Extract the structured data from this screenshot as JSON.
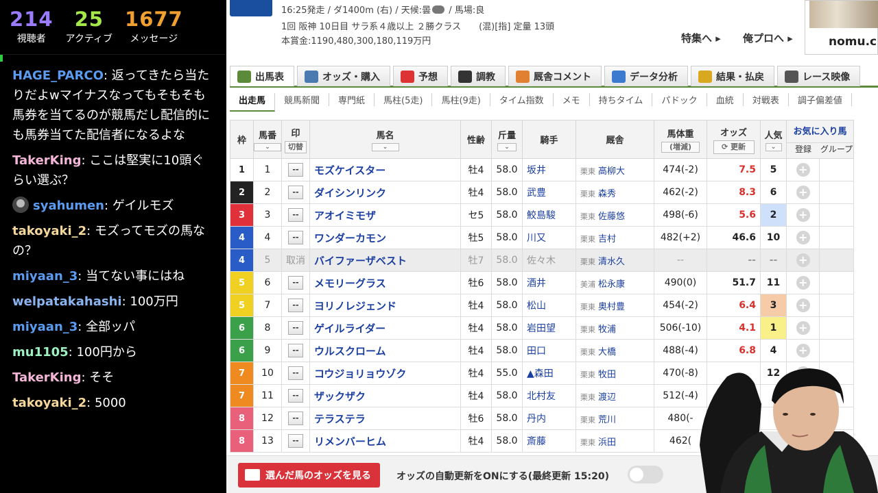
{
  "stats": [
    {
      "value": "214",
      "label": "視聴者",
      "color": "#9b7bff"
    },
    {
      "value": "25",
      "label": "アクティブ",
      "color": "#a5e84a"
    },
    {
      "value": "1677",
      "label": "メッセージ",
      "color": "#f0a030"
    }
  ],
  "chat": [
    {
      "user": "HAGE_PARCO",
      "text": "返ってきたら当たりだよwマイナスなってもそもそも馬券を当てるのが競馬だし配信的にも馬券当てた配信者になるよな",
      "color": "#5b9bf0"
    },
    {
      "user": "TakerKing",
      "text": "ここは堅実に10頭ぐらい選ぶ？",
      "color": "#f4b6d8"
    },
    {
      "user": "syahumen",
      "text": "ゲイルモズ",
      "color": "#5b9bf0",
      "avatar": true
    },
    {
      "user": "takoyaki_2",
      "text": "モズってモズの馬なの？",
      "color": "#f4d79a"
    },
    {
      "user": "miyaan_3",
      "text": "当てない事にはね",
      "color": "#5b9bf0"
    },
    {
      "user": "welpatakahashi",
      "text": "100万円",
      "color": "#8ab4f0"
    },
    {
      "user": "miyaan_3",
      "text": "全部ッパ",
      "color": "#5b9bf0"
    },
    {
      "user": "mu1105",
      "text": "100円から",
      "color": "#9ef0c0"
    },
    {
      "user": "TakerKing",
      "text": "そそ",
      "color": "#f4b6d8"
    },
    {
      "user": "takoyaki_2",
      "text": "5000",
      "color": "#f4d79a"
    }
  ],
  "race": {
    "line1a": "16:25発走 / ダ1400m (右) / 天候:曇",
    "line1b": " / 馬場:良",
    "line2": "1回 阪神 10日目 サラ系４歳以上 ２勝クラス　　(混)[指] 定量 13頭",
    "line3": "本賞金:1190,480,300,180,119万円"
  },
  "links": {
    "tokushu": "特集へ ▸",
    "orepuro": "俺プロへ ▸"
  },
  "ad": {
    "text": "nomu.c"
  },
  "tabs": [
    {
      "label": "出馬表",
      "icon_color": "#5a8a3a"
    },
    {
      "label": "オッズ・購入",
      "icon_color": "#4a7ab0"
    },
    {
      "label": "予想",
      "icon_color": "#d33"
    },
    {
      "label": "調教",
      "icon_color": "#333"
    },
    {
      "label": "厩舎コメント",
      "icon_color": "#e08030"
    },
    {
      "label": "データ分析",
      "icon_color": "#3a7acf"
    },
    {
      "label": "結果・払戻",
      "icon_color": "#d8a820"
    },
    {
      "label": "レース映像",
      "icon_color": "#555"
    }
  ],
  "subnav": [
    "出走馬",
    "競馬新聞",
    "専門紙",
    "馬柱(5走)",
    "馬柱(9走)",
    "タイム指数",
    "メモ",
    "持ちタイム",
    "パドック",
    "血統",
    "対戦表",
    "調子偏差値"
  ],
  "headers": {
    "waku": "枠",
    "umaban": "馬番",
    "mark": "印",
    "mark_sub": "切替",
    "name": "馬名",
    "sexage": "性齢",
    "weight": "斤量",
    "jockey": "騎手",
    "trainer": "厩舎",
    "body": "馬体重",
    "body_sub": "(増減)",
    "odds": "オッズ",
    "odds_btn": "更新",
    "pop": "人気",
    "fav": "お気に入り馬",
    "fav_reg": "登録",
    "fav_group": "グループ"
  },
  "horses": [
    {
      "waku": "1",
      "wcolor": "#ffffff",
      "wtext": "#222",
      "num": "1",
      "mark": "--",
      "name": "モズケイスター",
      "sa": "牡4",
      "wt": "58.0",
      "jockey": "坂井",
      "area": "栗東",
      "trainer": "高柳大",
      "body": "474(-2)",
      "odds": "7.5",
      "hot": true,
      "pop": "5",
      "popbg": ""
    },
    {
      "waku": "2",
      "wcolor": "#222222",
      "wtext": "#fff",
      "num": "2",
      "mark": "--",
      "name": "ダイシンリンク",
      "sa": "牡4",
      "wt": "58.0",
      "jockey": "武豊",
      "area": "栗東",
      "trainer": "森秀",
      "body": "462(-2)",
      "odds": "8.3",
      "hot": true,
      "pop": "6",
      "popbg": ""
    },
    {
      "waku": "3",
      "wcolor": "#e0303a",
      "wtext": "#fff",
      "num": "3",
      "mark": "--",
      "name": "アオイミモザ",
      "sa": "セ5",
      "wt": "58.0",
      "jockey": "鮫島駿",
      "area": "栗東",
      "trainer": "佐藤悠",
      "body": "498(-6)",
      "odds": "5.6",
      "hot": true,
      "pop": "2",
      "popbg": "#cfe0fb"
    },
    {
      "waku": "4",
      "wcolor": "#2a5cc8",
      "wtext": "#fff",
      "num": "4",
      "mark": "--",
      "name": "ワンダーカモン",
      "sa": "牡5",
      "wt": "58.0",
      "jockey": "川又",
      "area": "栗東",
      "trainer": "吉村",
      "body": "482(+2)",
      "odds": "46.6",
      "hot": false,
      "pop": "10",
      "popbg": ""
    },
    {
      "waku": "4",
      "wcolor": "#2a5cc8",
      "wtext": "#fff",
      "num": "5",
      "mark": "取消",
      "name": "バイファーザベスト",
      "sa": "牡7",
      "wt": "58.0",
      "jockey": "佐々木",
      "area": "栗東",
      "trainer": "清水久",
      "body": "--",
      "odds": "--",
      "hot": false,
      "pop": "--",
      "popbg": "",
      "scratched": true
    },
    {
      "waku": "5",
      "wcolor": "#f0d020",
      "wtext": "#fff",
      "num": "6",
      "mark": "--",
      "name": "メモリーグラス",
      "sa": "牡6",
      "wt": "58.0",
      "jockey": "酒井",
      "area": "美浦",
      "trainer": "松永康",
      "body": "490(0)",
      "odds": "51.7",
      "hot": false,
      "pop": "11",
      "popbg": ""
    },
    {
      "waku": "5",
      "wcolor": "#f0d020",
      "wtext": "#fff",
      "num": "7",
      "mark": "--",
      "name": "ヨリノレジェンド",
      "sa": "牡4",
      "wt": "58.0",
      "jockey": "松山",
      "area": "栗東",
      "trainer": "奥村豊",
      "body": "454(-2)",
      "odds": "6.4",
      "hot": true,
      "pop": "3",
      "popbg": "#f6cba8"
    },
    {
      "waku": "6",
      "wcolor": "#3aa04a",
      "wtext": "#fff",
      "num": "8",
      "mark": "--",
      "name": "ゲイルライダー",
      "sa": "牡4",
      "wt": "58.0",
      "jockey": "岩田望",
      "area": "栗東",
      "trainer": "牧浦",
      "body": "506(-10)",
      "odds": "4.1",
      "hot": true,
      "pop": "1",
      "popbg": "#faf08a"
    },
    {
      "waku": "6",
      "wcolor": "#3aa04a",
      "wtext": "#fff",
      "num": "9",
      "mark": "--",
      "name": "ウルスクローム",
      "sa": "牡4",
      "wt": "58.0",
      "jockey": "田口",
      "area": "栗東",
      "trainer": "大橋",
      "body": "488(-4)",
      "odds": "6.8",
      "hot": true,
      "pop": "4",
      "popbg": ""
    },
    {
      "waku": "7",
      "wcolor": "#ee8a20",
      "wtext": "#fff",
      "num": "10",
      "mark": "--",
      "name": "コウジョリョウゾク",
      "sa": "牡4",
      "wt": "55.0",
      "jockey": "▲森田",
      "area": "栗東",
      "trainer": "牧田",
      "body": "470(-8)",
      "odds": "",
      "hot": false,
      "pop": "12",
      "popbg": ""
    },
    {
      "waku": "7",
      "wcolor": "#ee8a20",
      "wtext": "#fff",
      "num": "11",
      "mark": "--",
      "name": "ザックザク",
      "sa": "牡4",
      "wt": "58.0",
      "jockey": "北村友",
      "area": "栗東",
      "trainer": "渡辺",
      "body": "512(-4)",
      "odds": "",
      "hot": false,
      "pop": "",
      "popbg": ""
    },
    {
      "waku": "8",
      "wcolor": "#e8607a",
      "wtext": "#fff",
      "num": "12",
      "mark": "--",
      "name": "テラステラ",
      "sa": "牡6",
      "wt": "58.0",
      "jockey": "丹内",
      "area": "栗東",
      "trainer": "荒川",
      "body": "480(-",
      "odds": "",
      "hot": false,
      "pop": "",
      "popbg": ""
    },
    {
      "waku": "8",
      "wcolor": "#e8607a",
      "wtext": "#fff",
      "num": "13",
      "mark": "--",
      "name": "リメンバーヒム",
      "sa": "牡4",
      "wt": "58.0",
      "jockey": "斎藤",
      "area": "栗東",
      "trainer": "浜田",
      "body": "462(",
      "odds": "",
      "hot": false,
      "pop": "",
      "popbg": ""
    }
  ],
  "bottom": {
    "odds_button": "選んだ馬のオッズを見る",
    "auto_update": "オッズの自動更新をONにする(最終更新 15:20)"
  }
}
